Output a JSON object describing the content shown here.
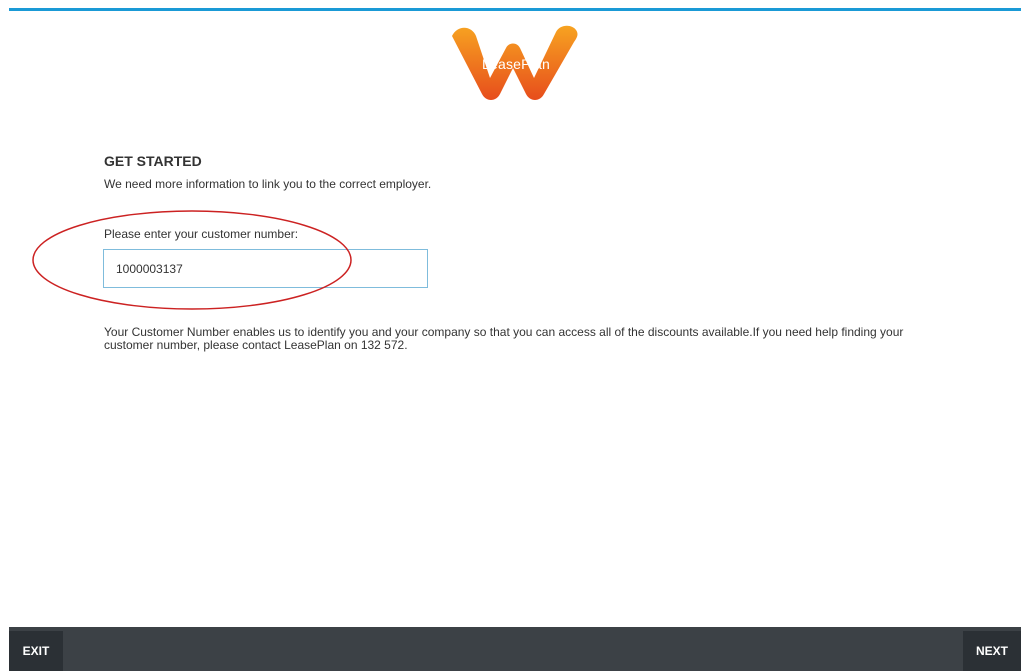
{
  "brand": {
    "logo_text": "LeasePlan",
    "accent_color": "#1a9ad6",
    "logo_colors": [
      "#f5a623",
      "#e8501e"
    ]
  },
  "main": {
    "heading": "GET STARTED",
    "subheading": "We need more information to link you to the correct employer.",
    "customer_number": {
      "label": "Please enter your customer number:",
      "value": "1000003137"
    },
    "help_text": "Your Customer Number enables us to identify you and your company so that you can access all of the discounts available.If you need help finding your customer number, please contact LeasePlan on 132 572."
  },
  "footer": {
    "exit_label": "EXIT",
    "next_label": "NEXT"
  },
  "annotation": {
    "shape": "ellipse",
    "color": "#cc2222"
  }
}
